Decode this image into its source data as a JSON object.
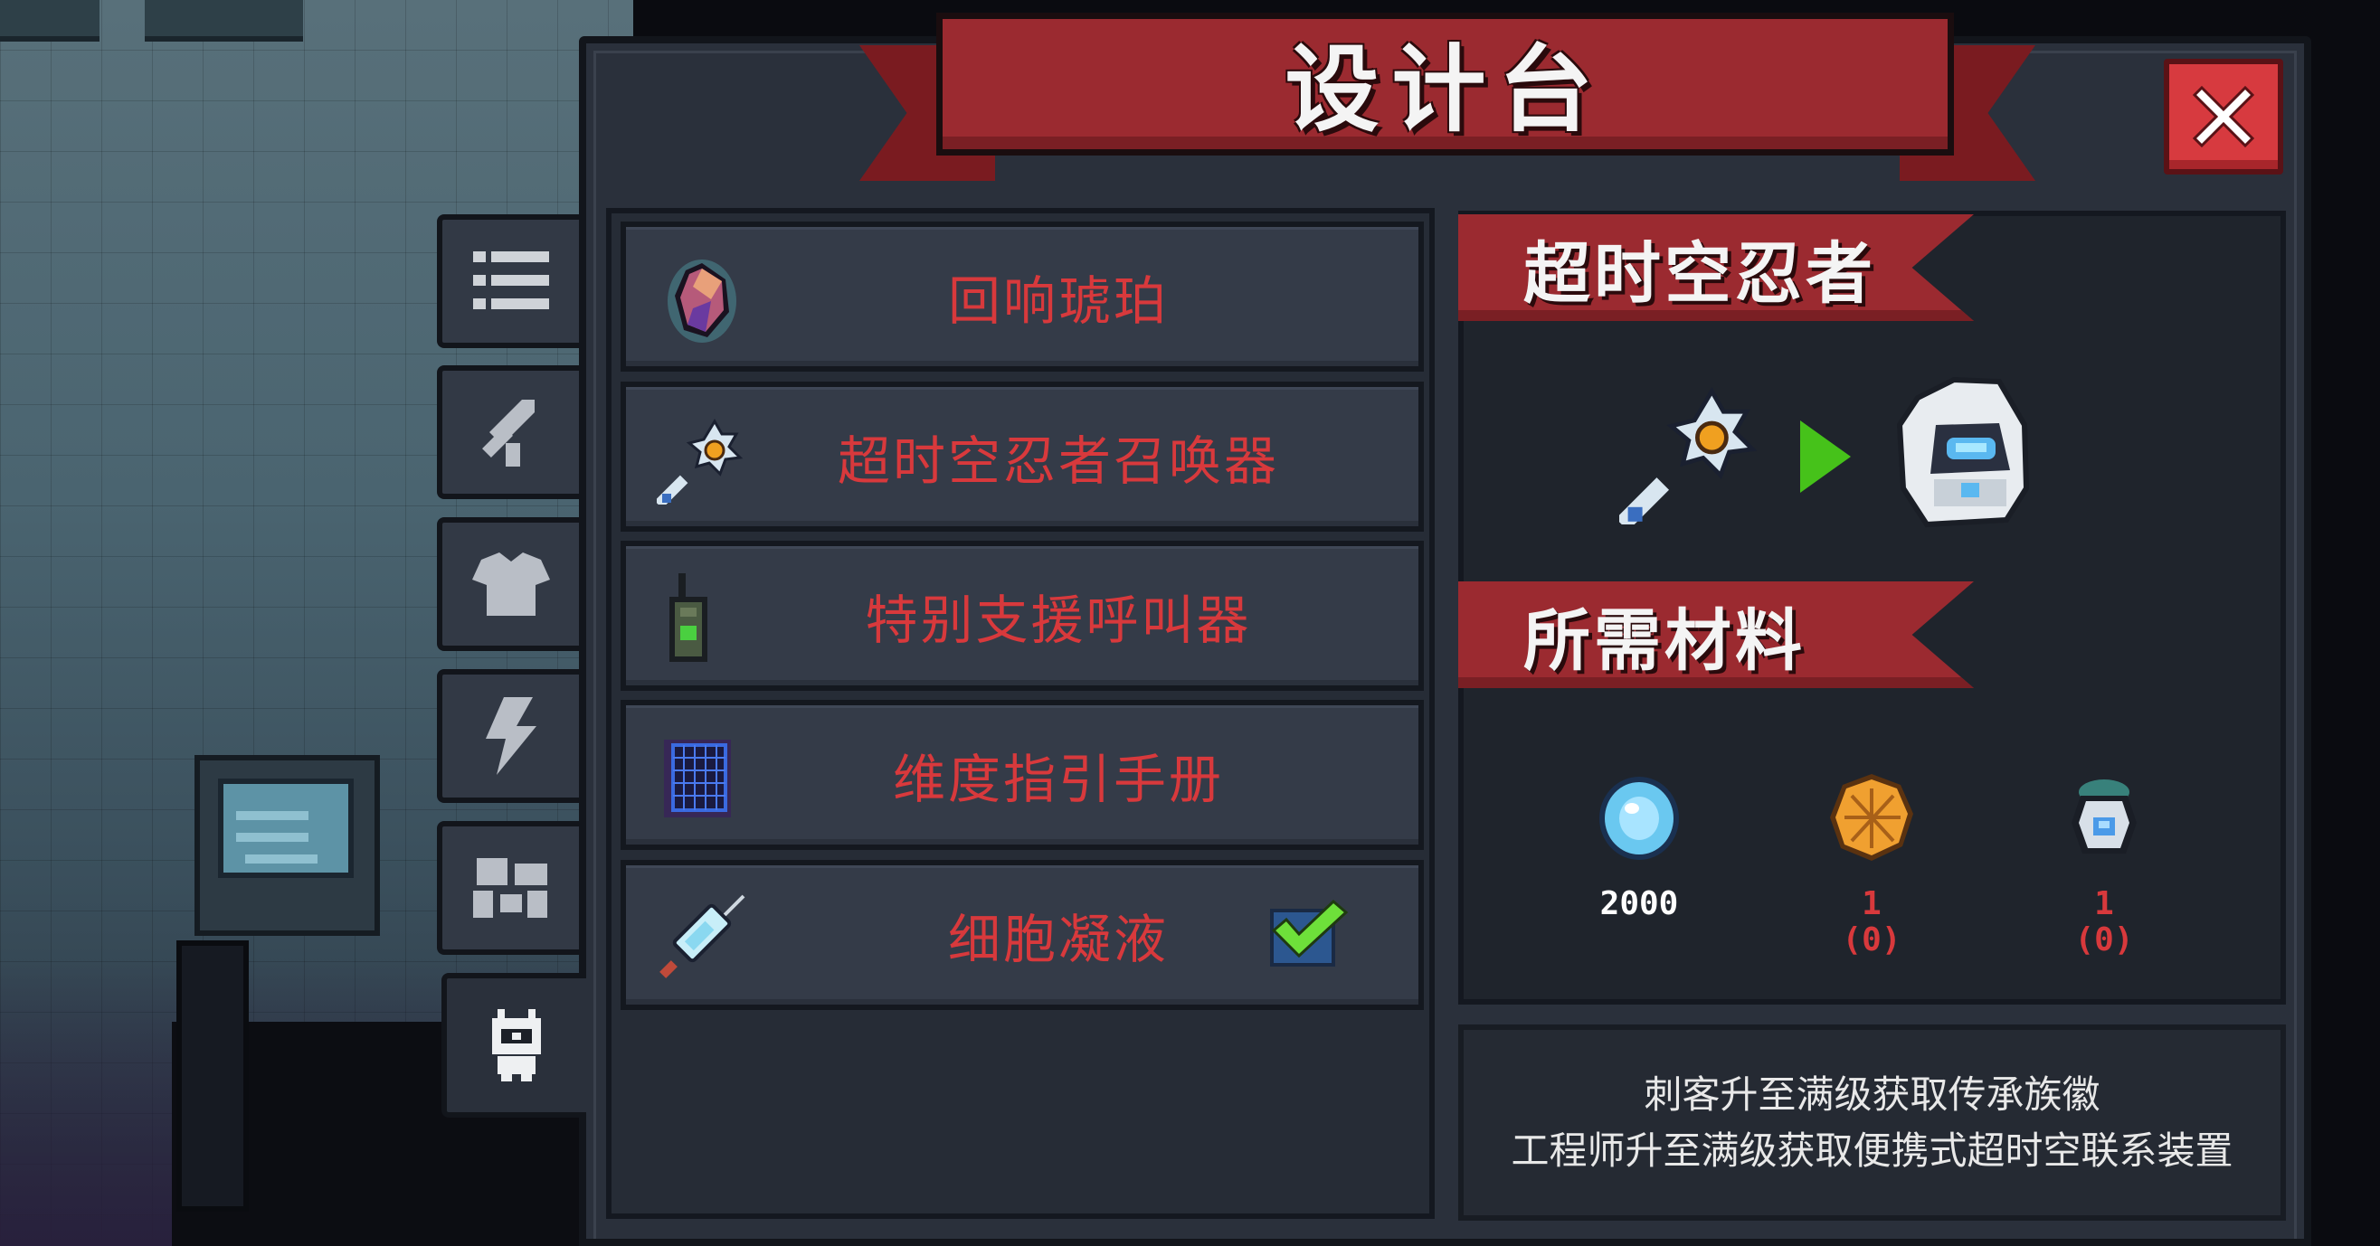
{
  "header": {
    "title": "设计台"
  },
  "tabs": [
    {
      "icon": "list-icon",
      "active": false
    },
    {
      "icon": "weapon-icon",
      "active": false
    },
    {
      "icon": "armor-icon",
      "active": false
    },
    {
      "icon": "lightning-icon",
      "active": false
    },
    {
      "icon": "robot-icon",
      "active": false
    },
    {
      "icon": "summon-character-icon",
      "active": true
    }
  ],
  "recipes": [
    {
      "label": "回响琥珀",
      "icon": "amber-gem-icon",
      "checked": false
    },
    {
      "label": "超时空忍者召唤器",
      "icon": "scepter-icon",
      "checked": false
    },
    {
      "label": "特别支援呼叫器",
      "icon": "walkie-talkie-icon",
      "checked": false
    },
    {
      "label": "维度指引手册",
      "icon": "grid-book-icon",
      "checked": false
    },
    {
      "label": "细胞凝液",
      "icon": "syringe-icon",
      "checked": true
    }
  ],
  "detail": {
    "name": "超时空忍者",
    "materials_title": "所需材料",
    "materials": [
      {
        "icon": "blue-gem-icon",
        "count": "2000",
        "owned": "",
        "color": "#ffffff"
      },
      {
        "icon": "gold-coin-icon",
        "count": "1",
        "owned": "(0)",
        "color": "#d8393c"
      },
      {
        "icon": "mech-part-icon",
        "count": "1",
        "owned": "(0)",
        "color": "#d8393c"
      }
    ],
    "description": [
      "刺客升至满级获取传承族徽",
      "工程师升至满级获取便携式超时空联系装置"
    ]
  },
  "colors": {
    "accent_red": "#d8393c",
    "ribbon": "#9b2a30",
    "arrow": "#46c21a",
    "check": "#6ee03a"
  }
}
